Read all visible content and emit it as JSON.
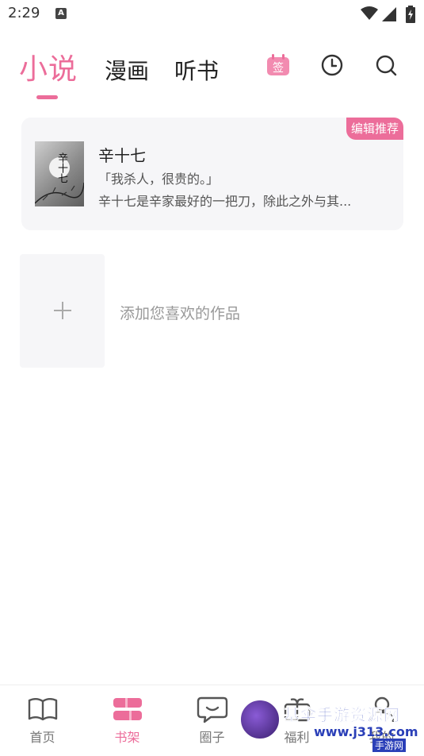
{
  "status_bar": {
    "time": "2:29",
    "notification_icon": "a-icon",
    "a_label": "A"
  },
  "top_tabs": [
    {
      "label": "小说",
      "active": true
    },
    {
      "label": "漫画",
      "active": false
    },
    {
      "label": "听书",
      "active": false
    }
  ],
  "header_actions": {
    "signin_label": "签",
    "signin_icon": "calendar-signin-icon",
    "history_icon": "clock-icon",
    "search_icon": "search-icon"
  },
  "recommendation": {
    "badge": "编辑推荐",
    "cover_title": "辛十七",
    "title": "辛十七",
    "quote": "「我杀人，很贵的。」",
    "description": "辛十七是辛家最好的一把刀，除此之外与其..."
  },
  "shelf": {
    "add_label": "添加您喜欢的作品",
    "add_icon": "plus-icon"
  },
  "bottom_nav": [
    {
      "label": "首页",
      "icon": "book-open-icon",
      "active": false
    },
    {
      "label": "书架",
      "icon": "bookshelf-icon",
      "active": true
    },
    {
      "label": "圈子",
      "icon": "chat-bubble-icon",
      "active": false
    },
    {
      "label": "福利",
      "icon": "gift-icon",
      "active": false
    },
    {
      "label": "我的",
      "icon": "person-icon",
      "active": false
    }
  ],
  "watermark": {
    "title": "基伞手游资源网",
    "url": "www.j313.com",
    "sub": "手游网"
  },
  "colors": {
    "accent": "#ec6d9a",
    "card_bg": "#f6f6f8",
    "text_muted": "#999999"
  }
}
